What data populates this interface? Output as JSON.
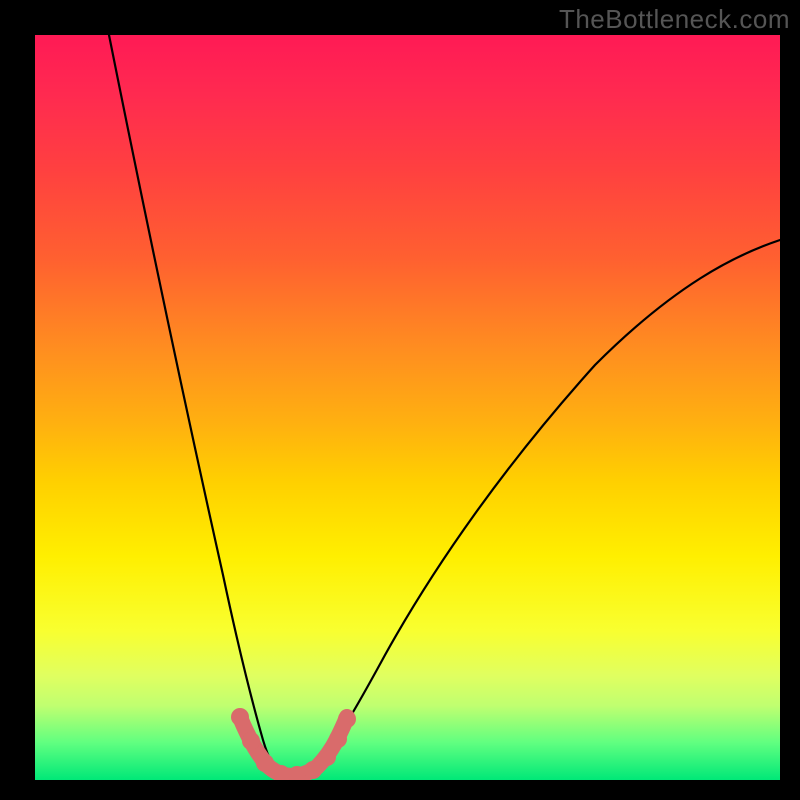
{
  "watermark": "TheBottleneck.com",
  "chart_data": {
    "type": "line",
    "title": "",
    "xlabel": "",
    "ylabel": "",
    "xlim": [
      0,
      100
    ],
    "ylim": [
      0,
      100
    ],
    "grid": false,
    "legend": false,
    "series": [
      {
        "name": "bottleneck-left",
        "x": [
          10,
          13,
          16,
          19,
          22,
          24,
          26,
          28,
          29.5,
          30.5,
          31.5
        ],
        "y": [
          100,
          82,
          66,
          50,
          34,
          22,
          13,
          7,
          3.5,
          1.5,
          0.5
        ]
      },
      {
        "name": "bottleneck-right",
        "x": [
          37,
          39,
          42,
          47,
          53,
          60,
          68,
          77,
          86,
          95,
          100
        ],
        "y": [
          0.5,
          3,
          8,
          17,
          27,
          37,
          47,
          56,
          63,
          69,
          72
        ]
      },
      {
        "name": "optimal-flat",
        "x": [
          31.5,
          33,
          35,
          37
        ],
        "y": [
          0.5,
          0.3,
          0.3,
          0.5
        ]
      }
    ],
    "markers": {
      "name": "highlighted-range",
      "color": "#d96b6b",
      "x": [
        27.5,
        29.5,
        31,
        33,
        35,
        37,
        38.5,
        40,
        41.5
      ],
      "y": [
        8,
        3,
        1,
        0.5,
        0.5,
        0.7,
        2,
        4,
        7
      ]
    },
    "gradient_stops": [
      {
        "pos": 0,
        "color": "#ff1a55"
      },
      {
        "pos": 18,
        "color": "#ff4040"
      },
      {
        "pos": 42,
        "color": "#ff8d20"
      },
      {
        "pos": 70,
        "color": "#ffef00"
      },
      {
        "pos": 90,
        "color": "#c0ff70"
      },
      {
        "pos": 100,
        "color": "#00e878"
      }
    ]
  }
}
